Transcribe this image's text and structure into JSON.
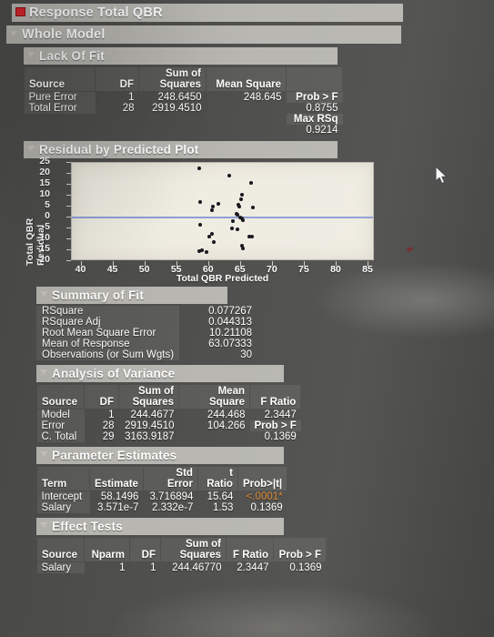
{
  "report": {
    "response_title": "Response Total QBR",
    "whole_model": "Whole Model"
  },
  "lack_of_fit": {
    "title": "Lack Of Fit",
    "columns": [
      "Source",
      "DF",
      "Sum of\nSquares",
      "Mean Square",
      ""
    ],
    "rows": [
      {
        "source": "Pure Error",
        "df": "1",
        "ss": "248.6450",
        "ms": "248.645",
        "extra": "Prob > F"
      },
      {
        "source": "Total Error",
        "df": "28",
        "ss": "2919.4510",
        "ms": "",
        "extra": "0.8755"
      }
    ],
    "max_rsq_label": "Max RSq",
    "max_rsq_value": "0.9214"
  },
  "residual_plot": {
    "title": "Residual by Predicted Plot"
  },
  "chart_data": {
    "type": "scatter",
    "title": "Residual by Predicted Plot",
    "xlabel": "Total QBR Predicted",
    "ylabel": "Total QBR Residual",
    "xlim": [
      38.5,
      86
    ],
    "ylim": [
      -20,
      25
    ],
    "xticks": [
      40,
      45,
      50,
      55,
      60,
      65,
      70,
      75,
      80,
      85
    ],
    "yticks": [
      25,
      20,
      15,
      10,
      5,
      0,
      -5,
      -10,
      -15,
      -20
    ],
    "grid": false,
    "reference_line": {
      "y": 0,
      "color": "#8f9fd4"
    },
    "points": [
      {
        "x": 58.5,
        "y": 22.5
      },
      {
        "x": 63.2,
        "y": 19.3
      },
      {
        "x": 66.6,
        "y": 16.0
      },
      {
        "x": 65.2,
        "y": 10.5
      },
      {
        "x": 65.0,
        "y": 8.2
      },
      {
        "x": 58.6,
        "y": 7.0
      },
      {
        "x": 61.5,
        "y": 6.2
      },
      {
        "x": 64.6,
        "y": 6.0
      },
      {
        "x": 64.7,
        "y": 5.2
      },
      {
        "x": 66.9,
        "y": 4.4
      },
      {
        "x": 60.6,
        "y": 4.9
      },
      {
        "x": 60.4,
        "y": 3.4
      },
      {
        "x": 64.3,
        "y": 1.6
      },
      {
        "x": 64.5,
        "y": 1.2
      },
      {
        "x": 64.9,
        "y": 0.2
      },
      {
        "x": 65.2,
        "y": -0.6
      },
      {
        "x": 65.3,
        "y": -1.2
      },
      {
        "x": 63.8,
        "y": -1.8
      },
      {
        "x": 58.6,
        "y": -3.2
      },
      {
        "x": 63.6,
        "y": -5.2
      },
      {
        "x": 64.4,
        "y": -5.3
      },
      {
        "x": 60.5,
        "y": -7.6
      },
      {
        "x": 60.0,
        "y": -8.8
      },
      {
        "x": 66.3,
        "y": -8.6
      },
      {
        "x": 66.8,
        "y": -8.8
      },
      {
        "x": 60.7,
        "y": -11.2
      },
      {
        "x": 65.2,
        "y": -13.0
      },
      {
        "x": 65.3,
        "y": -14.2
      },
      {
        "x": 58.9,
        "y": -14.8
      },
      {
        "x": 58.4,
        "y": -15.6
      },
      {
        "x": 59.6,
        "y": -16.0
      }
    ]
  },
  "summary_of_fit": {
    "title": "Summary of Fit",
    "rows": [
      {
        "label": "RSquare",
        "value": "0.077267"
      },
      {
        "label": "RSquare Adj",
        "value": "0.044313"
      },
      {
        "label": "Root Mean Square Error",
        "value": "10.21108"
      },
      {
        "label": "Mean of Response",
        "value": "63.07333"
      },
      {
        "label": "Observations (or Sum Wgts)",
        "value": "30"
      }
    ]
  },
  "analysis_of_variance": {
    "title": "Analysis of Variance",
    "columns": [
      "Source",
      "DF",
      "Sum of\nSquares",
      "Mean Square",
      "F Ratio"
    ],
    "rows": [
      {
        "source": "Model",
        "df": "1",
        "ss": "244.4677",
        "ms": "244.468",
        "f": "2.3447"
      },
      {
        "source": "Error",
        "df": "28",
        "ss": "2919.4510",
        "ms": "104.266",
        "f": "Prob > F"
      },
      {
        "source": "C. Total",
        "df": "29",
        "ss": "3163.9187",
        "ms": "",
        "f": "0.1369"
      }
    ]
  },
  "parameter_estimates": {
    "title": "Parameter Estimates",
    "columns": [
      "Term",
      "Estimate",
      "Std Error",
      "t Ratio",
      "Prob>|t|"
    ],
    "rows": [
      {
        "term": "Intercept",
        "estimate": "58.1496",
        "std_error": "3.716894",
        "t_ratio": "15.64",
        "prob": "<.0001*",
        "significant": true
      },
      {
        "term": "Salary",
        "estimate": "3.571e-7",
        "std_error": "2.332e-7",
        "t_ratio": "1.53",
        "prob": "0.1369",
        "significant": false
      }
    ]
  },
  "effect_tests": {
    "title": "Effect Tests",
    "columns": [
      "Source",
      "Nparm",
      "DF",
      "Sum of\nSquares",
      "F Ratio",
      "Prob > F"
    ],
    "rows": [
      {
        "source": "Salary",
        "nparm": "1",
        "df": "1",
        "ss": "244.46770",
        "f": "2.3447",
        "prob": "0.1369"
      }
    ]
  },
  "cursor": {
    "icon": "mouse-pointer-icon"
  }
}
